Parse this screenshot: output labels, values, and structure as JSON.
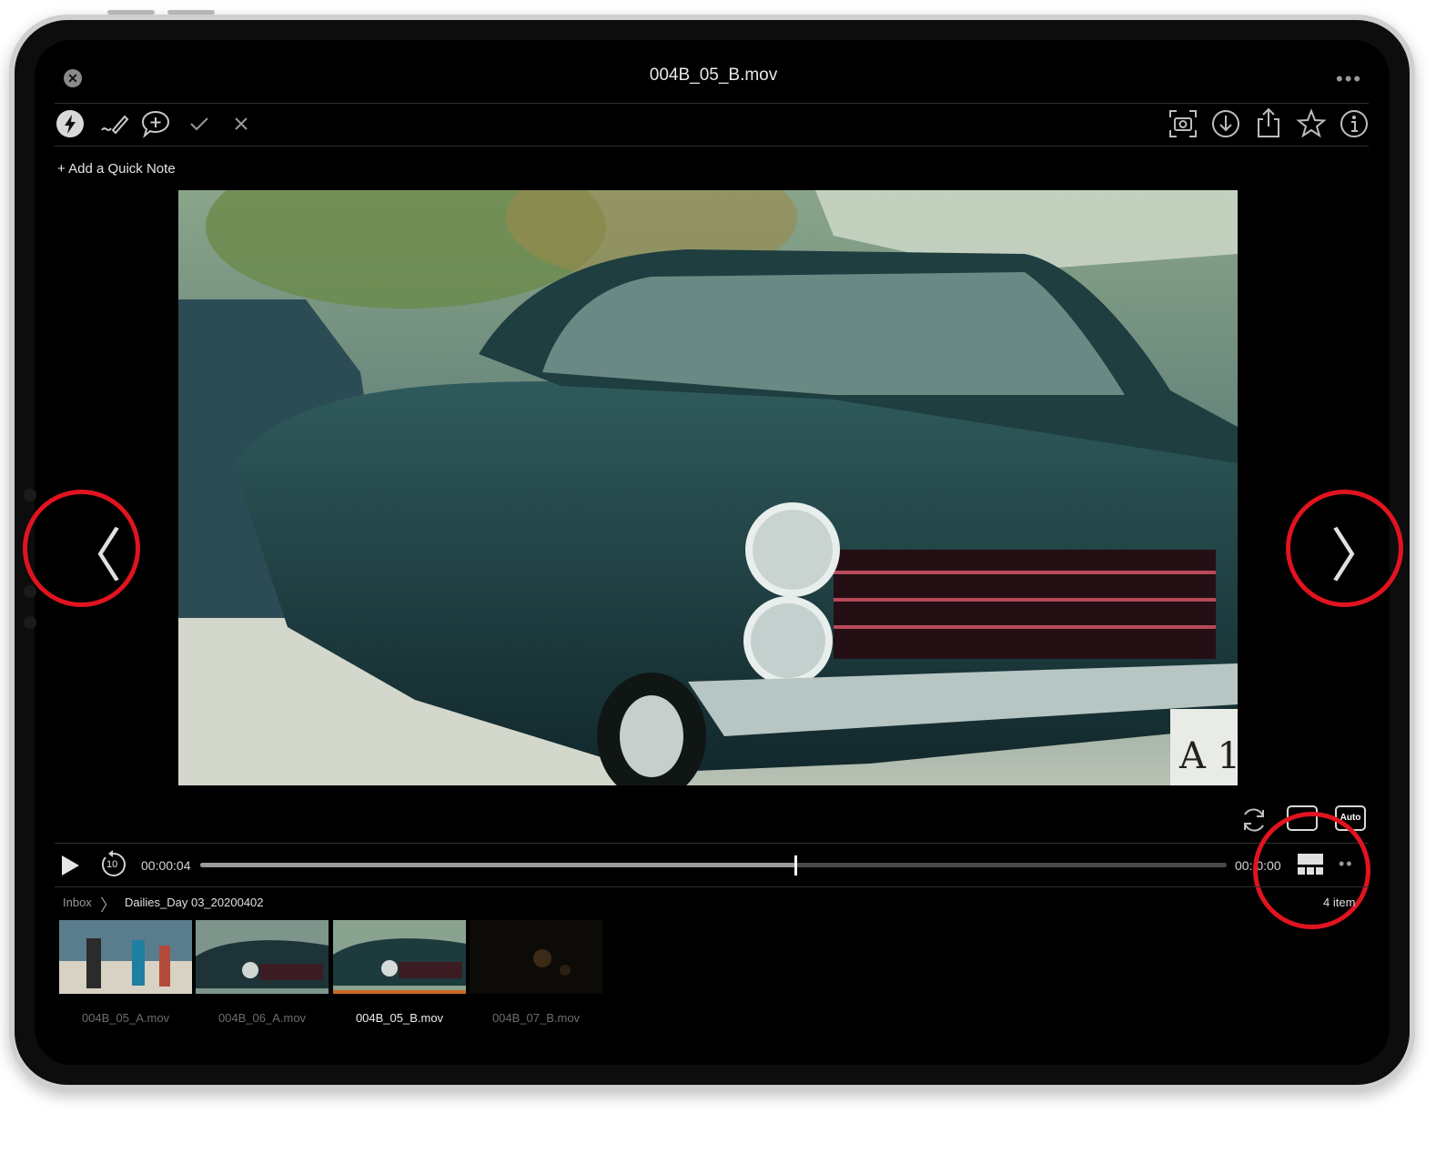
{
  "header": {
    "title": "004B_05_B.mov",
    "close_icon": "close-icon",
    "more_icon": "more-icon"
  },
  "toolbar": {
    "left_icons": [
      "flash-icon",
      "pen-icon",
      "comment-icon",
      "check-icon",
      "x-icon"
    ],
    "right_icons": [
      "snapshot-icon",
      "download-icon",
      "share-icon",
      "star-icon",
      "info-icon"
    ]
  },
  "quick_note": {
    "label": "+ Add a Quick Note"
  },
  "navigation": {
    "prev_icon": "chevron-left-icon",
    "next_icon": "chevron-right-icon",
    "highlight_color": "#e0141f"
  },
  "player_controls": {
    "refresh_icon": "refresh-icon",
    "mode_icon": "layout-mode-icon",
    "quality_label": "Auto",
    "play_icon": "play-icon",
    "replay_label": "10",
    "current_time": "00:00:04",
    "end_time": "00: 0:00",
    "progress": 0.58,
    "filmstrip_icon": "filmstrip-icon",
    "options_icon": "more-icon"
  },
  "breadcrumb": {
    "root": "Inbox",
    "folder": "Dailies_Day 03_20200402",
    "count": "4 item"
  },
  "thumbnails": [
    {
      "label": "004B_05_A.mov",
      "active": false
    },
    {
      "label": "004B_06_A.mov",
      "active": false
    },
    {
      "label": "004B_05_B.mov",
      "active": true
    },
    {
      "label": "004B_07_B.mov",
      "active": false
    }
  ],
  "colors": {
    "accent_orange": "#c96a21",
    "background": "#000000"
  }
}
